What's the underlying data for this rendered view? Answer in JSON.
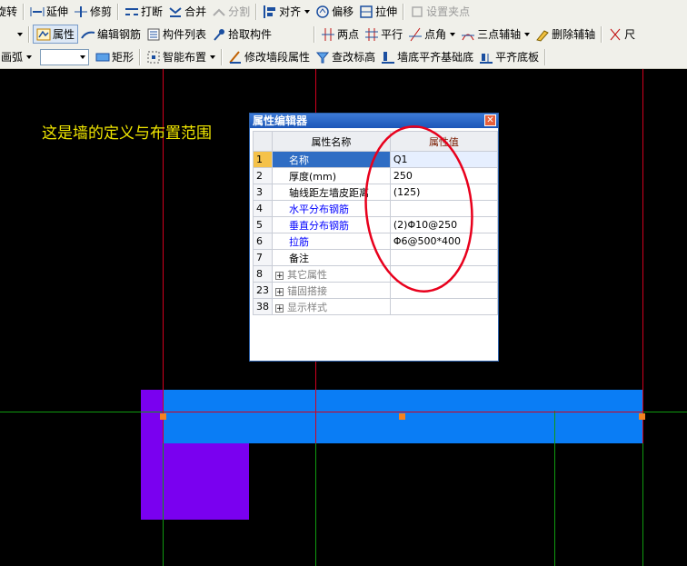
{
  "toolbar1": [
    {
      "label": "旋转",
      "icon": "rotate-icon"
    },
    {
      "label": "延伸",
      "icon": "extend-icon"
    },
    {
      "label": "修剪",
      "icon": "trim-icon"
    },
    {
      "label": "打断",
      "icon": "break-icon"
    },
    {
      "label": "合并",
      "icon": "merge-icon"
    },
    {
      "label": "分割",
      "icon": "split-icon",
      "disabled": true
    },
    {
      "label": "对齐",
      "icon": "align-icon",
      "dropdown": true
    },
    {
      "label": "偏移",
      "icon": "offset-icon"
    },
    {
      "label": "拉伸",
      "icon": "stretch-icon"
    },
    {
      "label": "设置夹点",
      "icon": "grip-icon",
      "disabled": true
    }
  ],
  "toolbar2": {
    "left": [
      {
        "label": "属性",
        "icon": "properties-icon",
        "pressed": true
      },
      {
        "label": "编辑钢筋",
        "icon": "edit-rebar-icon"
      },
      {
        "label": "构件列表",
        "icon": "component-list-icon"
      },
      {
        "label": "拾取构件",
        "icon": "pick-component-icon"
      }
    ],
    "right": [
      {
        "label": "两点",
        "icon": "two-point-icon"
      },
      {
        "label": "平行",
        "icon": "parallel-icon"
      },
      {
        "label": "点角",
        "icon": "point-angle-icon",
        "dropdown": true
      },
      {
        "label": "三点辅轴",
        "icon": "three-point-axis-icon",
        "dropdown": true
      },
      {
        "label": "删除辅轴",
        "icon": "delete-axis-icon"
      },
      {
        "label": "尺",
        "icon": "ruler-icon"
      }
    ]
  },
  "toolbar3": {
    "draw_mode": "画弧",
    "combo_value": "",
    "buttons": [
      {
        "label": "矩形",
        "icon": "rectangle-icon"
      },
      {
        "label": "智能布置",
        "icon": "smart-layout-icon",
        "dropdown": true
      },
      {
        "label": "修改墙段属性",
        "icon": "modify-wall-icon"
      },
      {
        "label": "查改标高",
        "icon": "check-elevation-icon"
      },
      {
        "label": "墙底平齐基础底",
        "icon": "wall-bottom-align-icon"
      },
      {
        "label": "平齐底板",
        "icon": "align-slab-icon"
      }
    ]
  },
  "annotation": "这是墙的定义与布置范围",
  "dialog": {
    "title": "属性编辑器",
    "col_name": "属性名称",
    "col_value": "属性值",
    "rows": [
      {
        "num": "1",
        "name": "名称",
        "value": "Q1",
        "style": "sel"
      },
      {
        "num": "2",
        "name": "厚度(mm)",
        "value": "250",
        "style": ""
      },
      {
        "num": "3",
        "name": "轴线距左墙皮距离",
        "value": "(125)",
        "style": ""
      },
      {
        "num": "4",
        "name": "水平分布钢筋",
        "value": "",
        "style": "blue"
      },
      {
        "num": "5",
        "name": "垂直分布钢筋",
        "value": "(2)Φ10@250",
        "style": "blue"
      },
      {
        "num": "6",
        "name": "拉筋",
        "value": "Φ6@500*400",
        "style": "blue"
      },
      {
        "num": "7",
        "name": "备注",
        "value": "",
        "style": ""
      },
      {
        "num": "8",
        "name": "其它属性",
        "value": "",
        "style": "gray",
        "expand": true
      },
      {
        "num": "23",
        "name": "锚固搭接",
        "value": "",
        "style": "gray",
        "expand": true
      },
      {
        "num": "38",
        "name": "显示样式",
        "value": "",
        "style": "gray",
        "expand": true
      }
    ]
  },
  "colors": {
    "wall": "#0a7df5",
    "column": "#7a00f0",
    "axis_red": "#d2001e",
    "axis_green": "#109a10",
    "grip": "#f58220",
    "annotation": "#f0e600",
    "highlight": "#e8001c"
  }
}
